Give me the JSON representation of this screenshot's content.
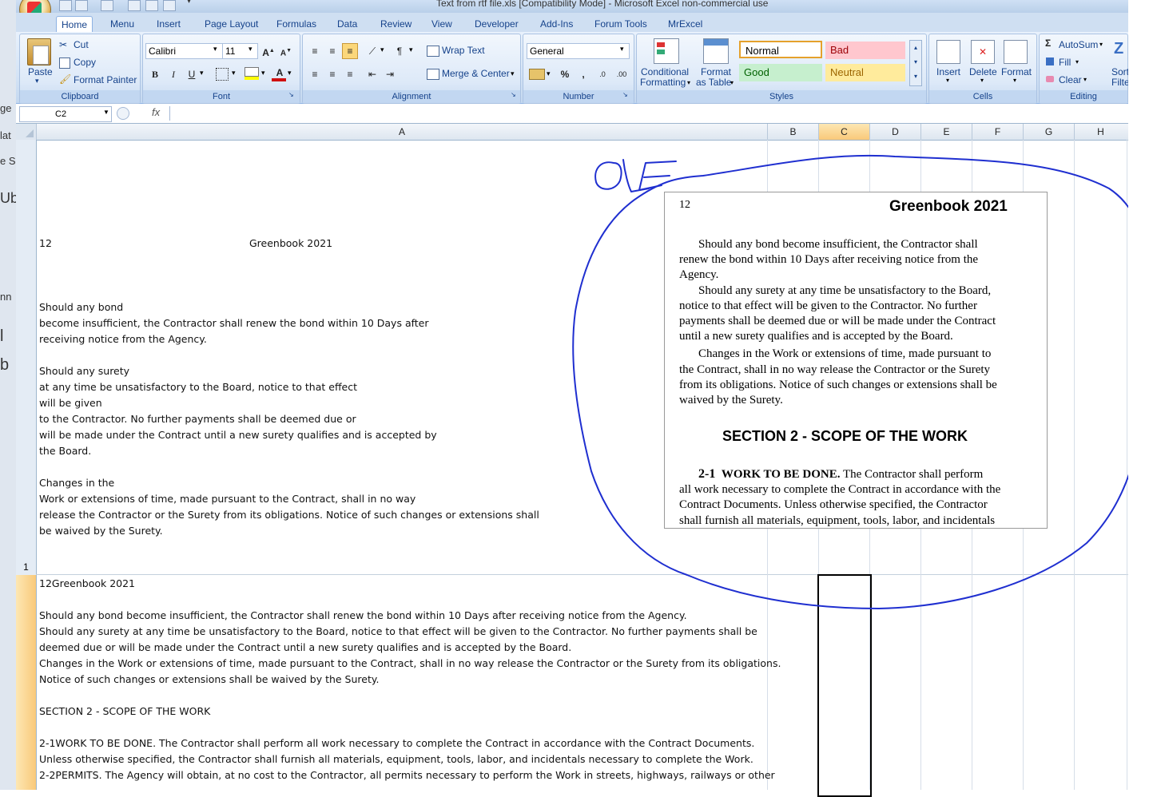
{
  "window": {
    "title": "Text from rtf file.xls  [Compatibility Mode] - Microsoft Excel non-commercial use"
  },
  "background_window": {
    "fragments": [
      "ge",
      "lat",
      "e S",
      "Ub",
      "nn",
      "l",
      "b"
    ]
  },
  "tabs": [
    "Home",
    "Menu",
    "Insert",
    "Page Layout",
    "Formulas",
    "Data",
    "Review",
    "View",
    "Developer",
    "Add-Ins",
    "Forum Tools",
    "MrExcel"
  ],
  "ribbon": {
    "clipboard": {
      "label": "Clipboard",
      "paste": "Paste",
      "cut": "Cut",
      "copy": "Copy",
      "format_painter": "Format Painter"
    },
    "font": {
      "label": "Font",
      "name": "Calibri",
      "size": "11"
    },
    "alignment": {
      "label": "Alignment",
      "wrap_text": "Wrap Text",
      "merge_center": "Merge & Center"
    },
    "number": {
      "label": "Number",
      "format": "General"
    },
    "styles": {
      "label": "Styles",
      "conditional": "Conditional",
      "formatting": "Formatting",
      "format": "Format",
      "as_table": "as Table",
      "normal": "Normal",
      "bad": "Bad",
      "good": "Good",
      "neutral": "Neutral"
    },
    "cells": {
      "label": "Cells",
      "insert": "Insert",
      "delete": "Delete",
      "format": "Format"
    },
    "editing": {
      "label": "Editing",
      "autosum": "AutoSum",
      "fill": "Fill",
      "clear": "Clear",
      "sort": "Sort",
      "filter": "Filte"
    }
  },
  "formula_bar": {
    "name_box": "C2",
    "fx": "fx",
    "value": ""
  },
  "columns": [
    "A",
    "B",
    "C",
    "D",
    "E",
    "F",
    "G",
    "H"
  ],
  "rows": [
    "1"
  ],
  "row1": {
    "page_num": "12",
    "page_title": "Greenbook 2021",
    "lines": [
      "Should any bond",
      "become insufficient, the Contractor shall renew the bond within 10 Days after",
      "receiving notice from the Agency.",
      "",
      "Should any surety",
      "at any time be unsatisfactory to the Board, notice to that effect",
      "will be given",
      "to the Contractor. No further payments shall be deemed due or",
      "will be made under the Contract until a new surety qualifies and is accepted by",
      "the Board.",
      "",
      "Changes in the",
      "Work or extensions of time, made pursuant to the Contract, shall in no way",
      "release the Contractor or the Surety from its obligations. Notice of such changes or extensions shall",
      "be waived by the Surety."
    ]
  },
  "row2": {
    "lines": [
      "12Greenbook 2021",
      "",
      "Should any bond become insufficient, the Contractor shall renew the bond within 10 Days after receiving notice from the Agency.",
      "Should any surety at any time be unsatisfactory to the Board, notice to that effect will be given to the Contractor. No further payments shall be",
      "deemed due or will be made under the Contract until a new surety qualifies and is accepted by the Board.",
      "Changes in the Work or extensions of time, made pursuant to the Contract, shall in no way release the Contractor or the Surety from its obligations.",
      "Notice of such changes or extensions shall be waived by the Surety.",
      "",
      "SECTION 2 - SCOPE OF THE WORK",
      "",
      "2-1WORK TO BE DONE. The Contractor shall perform all work necessary to complete the Contract in accordance with the Contract Documents.",
      "Unless otherwise specified, the Contractor shall furnish all materials, equipment, tools, labor, and incidentals necessary to complete the Work.",
      "2-2PERMITS. The Agency will obtain, at no cost to the Contractor, all permits necessary to perform the Work in streets, highways, railways or other"
    ]
  },
  "annotation": {
    "text": "OLE",
    "color": "#1f2fd0"
  },
  "pdf_image": {
    "page_num": "12",
    "title": "Greenbook 2021",
    "lines": [
      "Should any bond become insufficient, the Contractor shall",
      "renew the bond within 10 Days after receiving notice from the",
      "Agency.",
      "Should any surety at any time be unsatisfactory to the Board,",
      "notice to that effect will be given to the Contractor. No further",
      "payments shall be deemed due or will be made under the Contract",
      "until a new surety qualifies and is accepted by the Board.",
      "Changes in the Work or extensions of time, made pursuant to",
      "the Contract, shall in no way release the Contractor or the Surety",
      "from its obligations. Notice of such changes or extensions shall be",
      "waived by the Surety."
    ],
    "section_heading": "SECTION 2 - SCOPE OF THE WORK",
    "subsection_num": "2-1",
    "subsection_title": "WORK TO BE DONE.",
    "subsection_lines": [
      "The Contractor shall perform",
      "all work necessary to complete the Contract in accordance with the",
      "Contract Documents. Unless otherwise specified, the Contractor",
      "shall furnish all materials, equipment, tools, labor, and incidentals"
    ]
  }
}
